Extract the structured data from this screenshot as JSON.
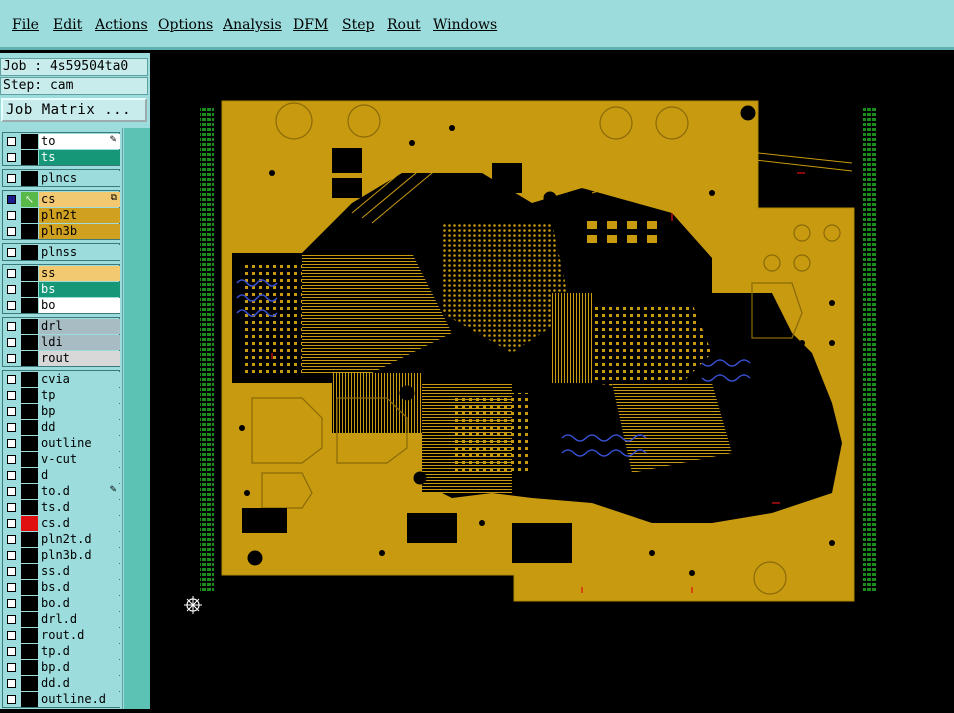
{
  "menu": [
    "File",
    "Edit",
    "Actions",
    "Options",
    "Analysis",
    "DFM",
    "Step",
    "Rout",
    "Windows"
  ],
  "job": "Job : 4s59504ta0",
  "step": "Step: cam",
  "job_matrix": "Job Matrix ...",
  "layers": [
    {
      "name": "to",
      "bg": "#ffffff",
      "icon": "✎"
    },
    {
      "name": "ts",
      "bg": "#169878",
      "color": "#ffffff"
    },
    {
      "name": "plncs",
      "bg": "#9cdcdc"
    },
    {
      "name": "cs",
      "bg": "#f2c870",
      "icon": "⧉",
      "selected": true
    },
    {
      "name": "pln2t",
      "bg": "#d0a020"
    },
    {
      "name": "pln3b",
      "bg": "#d0a020"
    },
    {
      "name": "plnss",
      "bg": "#9cdcdc"
    },
    {
      "name": "ss",
      "bg": "#f2c870"
    },
    {
      "name": "bs",
      "bg": "#169878",
      "color": "#ffffff"
    },
    {
      "name": "bo",
      "bg": "#ffffff"
    },
    {
      "name": "drl",
      "bg": "#a8bcc4"
    },
    {
      "name": "ldi",
      "bg": "#a8bcc4"
    },
    {
      "name": "rout",
      "bg": "#d8d8d8"
    },
    {
      "name": "cvia",
      "bg": "#9cdcdc"
    },
    {
      "name": "tp",
      "bg": "#9cdcdc"
    },
    {
      "name": "bp",
      "bg": "#9cdcdc"
    },
    {
      "name": "dd",
      "bg": "#9cdcdc"
    },
    {
      "name": "outline",
      "bg": "#9cdcdc"
    },
    {
      "name": "v-cut",
      "bg": "#9cdcdc"
    },
    {
      "name": "d",
      "bg": "#9cdcdc"
    },
    {
      "name": "to.d",
      "bg": "#9cdcdc",
      "icon": "✎"
    },
    {
      "name": "ts.d",
      "bg": "#9cdcdc"
    },
    {
      "name": "cs.d",
      "bg": "#9cdcdc",
      "red": true
    },
    {
      "name": "pln2t.d",
      "bg": "#9cdcdc"
    },
    {
      "name": "pln3b.d",
      "bg": "#9cdcdc"
    },
    {
      "name": "ss.d",
      "bg": "#9cdcdc"
    },
    {
      "name": "bs.d",
      "bg": "#9cdcdc"
    },
    {
      "name": "bo.d",
      "bg": "#9cdcdc"
    },
    {
      "name": "drl.d",
      "bg": "#9cdcdc"
    },
    {
      "name": "rout.d",
      "bg": "#9cdcdc"
    },
    {
      "name": "tp.d",
      "bg": "#9cdcdc"
    },
    {
      "name": "bp.d",
      "bg": "#9cdcdc"
    },
    {
      "name": "dd.d",
      "bg": "#9cdcdc"
    },
    {
      "name": "outline.d",
      "bg": "#9cdcdc"
    }
  ],
  "colors": {
    "copper": "#c89a10",
    "panel": "#9cdcdc",
    "trace": "#8a6a08",
    "blue_trace": "#3850d0",
    "green_rail": "#1c8a1c"
  }
}
